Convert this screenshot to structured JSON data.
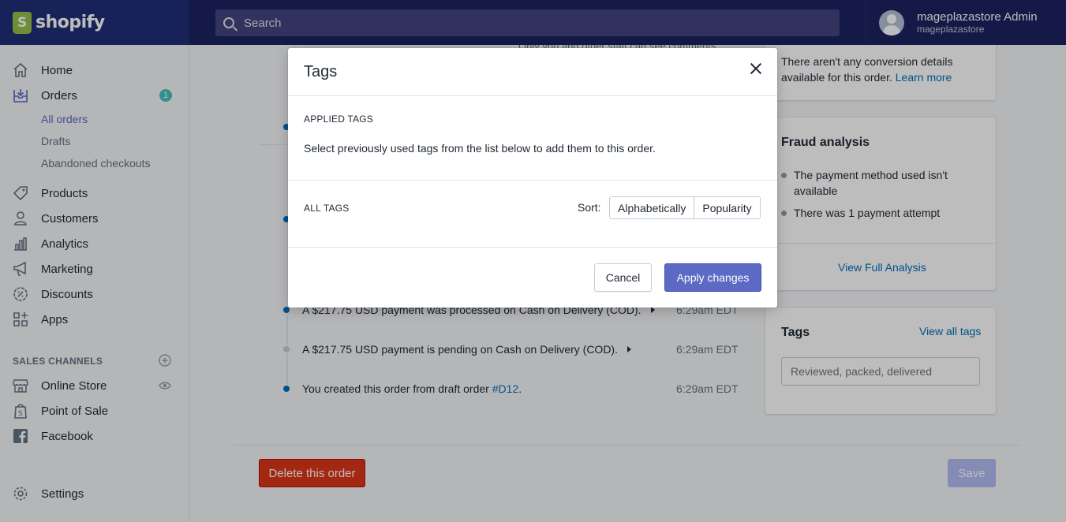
{
  "topbar": {
    "brand": "shopify",
    "search_placeholder": "Search",
    "user_name": "mageplazastore Admin",
    "store_name": "mageplazastore"
  },
  "sidebar": {
    "items": [
      {
        "label": "Home",
        "icon": "home-icon"
      },
      {
        "label": "Orders",
        "icon": "orders-icon",
        "badge": "1"
      },
      {
        "label": "Products",
        "icon": "tag-icon"
      },
      {
        "label": "Customers",
        "icon": "person-icon"
      },
      {
        "label": "Analytics",
        "icon": "bar-chart-icon"
      },
      {
        "label": "Marketing",
        "icon": "megaphone-icon"
      },
      {
        "label": "Discounts",
        "icon": "discount-icon"
      },
      {
        "label": "Apps",
        "icon": "apps-icon"
      }
    ],
    "orders_sub": [
      "All orders",
      "Drafts",
      "Abandoned checkouts"
    ],
    "sales_channels_heading": "SALES CHANNELS",
    "channels": [
      {
        "label": "Online Store",
        "icon": "store-icon"
      },
      {
        "label": "Point of Sale",
        "icon": "pos-icon"
      },
      {
        "label": "Facebook",
        "icon": "facebook-icon"
      }
    ],
    "settings": "Settings"
  },
  "main": {
    "top_partial_text": "Only you and other staff can see comments",
    "timeline": [
      {
        "text": "A $217.75 USD payment was processed on Cash on Delivery (COD).",
        "time": "6:29am EDT",
        "status": "complete"
      },
      {
        "text": "A $217.75 USD payment is pending on Cash on Delivery (COD).",
        "time": "6:29am EDT",
        "status": "pending"
      },
      {
        "text_prefix": "You created this order from draft order ",
        "link": "#D12",
        "text_suffix": ".",
        "time": "6:29am EDT",
        "status": "complete"
      }
    ],
    "conversion": {
      "text": "There aren't any conversion details available for this order.",
      "link": "Learn more"
    },
    "fraud": {
      "title": "Fraud analysis",
      "bullets": [
        "The payment method used isn't available",
        "There was 1 payment attempt"
      ],
      "link": "View Full Analysis"
    },
    "tags_card": {
      "title": "Tags",
      "link": "View all tags",
      "placeholder": "Reviewed, packed, delivered"
    },
    "delete_label": "Delete this order",
    "save_label": "Save"
  },
  "modal": {
    "title": "Tags",
    "applied_heading": "APPLIED TAGS",
    "applied_text": "Select previously used tags from the list below to add them to this order.",
    "all_heading": "ALL TAGS",
    "sort_label": "Sort:",
    "sort_options": [
      "Alphabetically",
      "Popularity"
    ],
    "cancel_label": "Cancel",
    "apply_label": "Apply changes"
  },
  "colors": {
    "topbar": "#1c2260",
    "primary": "#5c6ac4",
    "danger": "#de3618",
    "link": "#006fbb",
    "badge": "#47c1bf"
  }
}
